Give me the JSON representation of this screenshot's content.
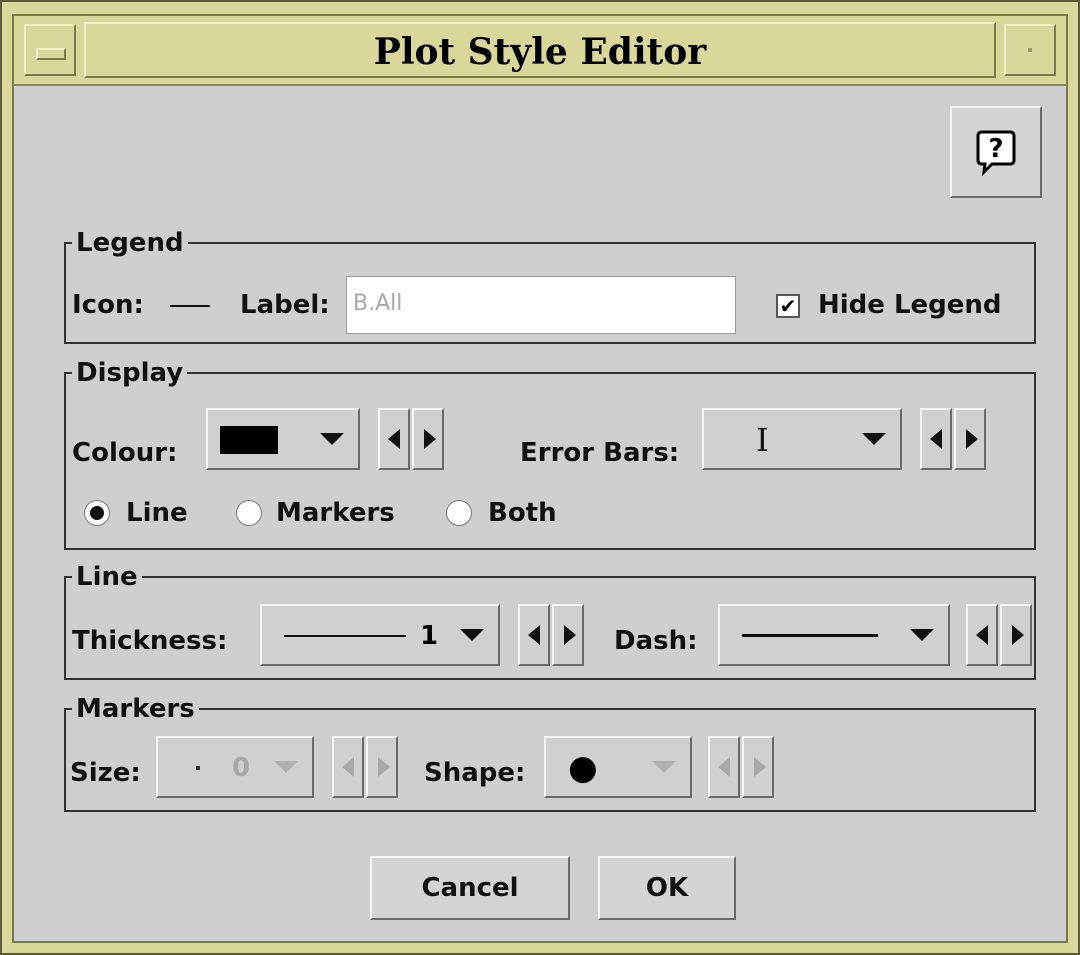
{
  "window": {
    "title": "Plot Style Editor"
  },
  "legend": {
    "group_title": "Legend",
    "icon_label": "Icon:",
    "label_label": "Label:",
    "label_value": "B.All",
    "hide_legend_label": "Hide Legend",
    "hide_legend_checked": true
  },
  "display": {
    "group_title": "Display",
    "colour_label": "Colour:",
    "colour_value": "#000000",
    "error_bars_label": "Error Bars:",
    "error_bars_value": "I",
    "style_options": [
      {
        "label": "Line",
        "selected": true
      },
      {
        "label": "Markers",
        "selected": false
      },
      {
        "label": "Both",
        "selected": false
      }
    ]
  },
  "line": {
    "group_title": "Line",
    "thickness_label": "Thickness:",
    "thickness_value": "1",
    "dash_label": "Dash:"
  },
  "markers": {
    "group_title": "Markers",
    "size_label": "Size:",
    "size_value": "0",
    "shape_label": "Shape:",
    "shape_value": "●"
  },
  "buttons": {
    "cancel": "Cancel",
    "ok": "OK"
  },
  "icons": {
    "help": "help-bubble-icon"
  }
}
